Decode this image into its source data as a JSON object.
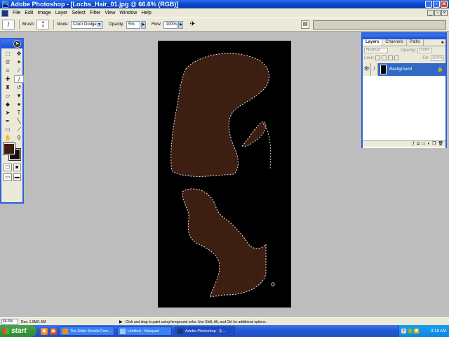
{
  "window": {
    "title": "Adobe Photoshop - [Lochs_Hair_01.jpg @ 66.6% (RGB)]"
  },
  "menu": [
    "File",
    "Edit",
    "Image",
    "Layer",
    "Select",
    "Filter",
    "View",
    "Window",
    "Help"
  ],
  "options_bar": {
    "brush_label": "Brush:",
    "brush_size": "9",
    "mode_label": "Mode:",
    "mode_value": "Color Dodge",
    "opacity_label": "Opacity:",
    "opacity_value": "5%",
    "flow_label": "Flow:",
    "flow_value": "100%"
  },
  "layers_palette": {
    "tabs": [
      "Layers",
      "Channels",
      "Paths"
    ],
    "blend_mode": "Normal",
    "opacity_label": "Opacity:",
    "opacity_value": "100%",
    "lock_label": "Lock:",
    "fill_label": "Fill:",
    "fill_value": "100%",
    "layer_name": "Background"
  },
  "status_bar": {
    "zoom": "66.6%",
    "doc_size": "Doc: 1.5M/1.5M",
    "hint": "Click and drag to paint using foreground color. Use Shift, Alt, and Ctrl for additional options."
  },
  "taskbar": {
    "start_label": "start",
    "tasks": [
      {
        "label": "The Elder Scrolls Foru..."
      },
      {
        "label": "Untitled - Notepad"
      },
      {
        "label": "Adobe Photoshop - [L..."
      }
    ],
    "clock": "3:18 AM"
  },
  "colors": {
    "foreground": "#3a1e12",
    "background": "#141010",
    "hair_fill": "#3a1d10",
    "canvas_bg": "#000000"
  }
}
